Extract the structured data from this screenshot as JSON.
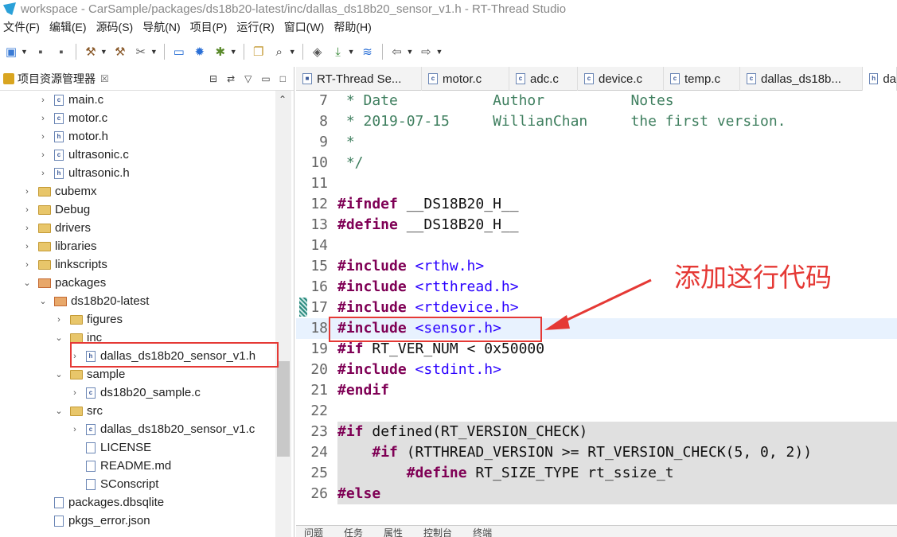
{
  "window": {
    "title": "workspace - CarSample/packages/ds18b20-latest/inc/dallas_ds18b20_sensor_v1.h - RT-Thread Studio"
  },
  "menu": [
    "文件(F)",
    "编辑(E)",
    "源码(S)",
    "导航(N)",
    "项目(P)",
    "运行(R)",
    "窗口(W)",
    "帮助(H)"
  ],
  "explorer": {
    "title": "项目资源管理器",
    "close": "☒",
    "items": [
      {
        "label": "main.c",
        "type": "c"
      },
      {
        "label": "motor.c",
        "type": "c"
      },
      {
        "label": "motor.h",
        "type": "h"
      },
      {
        "label": "ultrasonic.c",
        "type": "c"
      },
      {
        "label": "ultrasonic.h",
        "type": "h"
      },
      {
        "label": "cubemx",
        "type": "dir"
      },
      {
        "label": "Debug",
        "type": "dir"
      },
      {
        "label": "drivers",
        "type": "dir"
      },
      {
        "label": "libraries",
        "type": "dir"
      },
      {
        "label": "linkscripts",
        "type": "dir"
      },
      {
        "label": "packages",
        "type": "pkg"
      },
      {
        "label": "ds18b20-latest",
        "type": "pkg"
      },
      {
        "label": "figures",
        "type": "dir"
      },
      {
        "label": "inc",
        "type": "dir"
      },
      {
        "label": "dallas_ds18b20_sensor_v1.h",
        "type": "h"
      },
      {
        "label": "sample",
        "type": "dir"
      },
      {
        "label": "ds18b20_sample.c",
        "type": "c"
      },
      {
        "label": "src",
        "type": "dir"
      },
      {
        "label": "dallas_ds18b20_sensor_v1.c",
        "type": "c"
      },
      {
        "label": "LICENSE",
        "type": "file"
      },
      {
        "label": "README.md",
        "type": "file"
      },
      {
        "label": "SConscript",
        "type": "file"
      },
      {
        "label": "packages.dbsqlite",
        "type": "file"
      },
      {
        "label": "pkgs_error.json",
        "type": "file"
      }
    ]
  },
  "tabs": [
    "RT-Thread Se...",
    "motor.c",
    "adc.c",
    "device.c",
    "temp.c",
    "dallas_ds18b...",
    "da"
  ],
  "code": [
    {
      "n": "7",
      "segments": [
        {
          "c": "cm",
          "t": " * Date           Author          Notes"
        }
      ]
    },
    {
      "n": "8",
      "segments": [
        {
          "c": "cm",
          "t": " * 2019-07-15     WillianChan     the first version."
        }
      ]
    },
    {
      "n": "9",
      "segments": [
        {
          "c": "cm",
          "t": " *"
        }
      ]
    },
    {
      "n": "10",
      "segments": [
        {
          "c": "cm",
          "t": " */"
        }
      ]
    },
    {
      "n": "11",
      "segments": []
    },
    {
      "n": "12",
      "segments": [
        {
          "c": "kw",
          "t": "#ifndef"
        },
        {
          "c": "nm",
          "t": " __DS18B20_H__"
        }
      ]
    },
    {
      "n": "13",
      "segments": [
        {
          "c": "kw",
          "t": "#define"
        },
        {
          "c": "nm",
          "t": " __DS18B20_H__"
        }
      ]
    },
    {
      "n": "14",
      "segments": []
    },
    {
      "n": "15",
      "segments": [
        {
          "c": "kw",
          "t": "#include"
        },
        {
          "c": "str",
          "t": " <rthw.h>"
        }
      ]
    },
    {
      "n": "16",
      "segments": [
        {
          "c": "kw",
          "t": "#include"
        },
        {
          "c": "str",
          "t": " <rtthread.h>"
        }
      ]
    },
    {
      "n": "17",
      "segments": [
        {
          "c": "kw",
          "t": "#include"
        },
        {
          "c": "str",
          "t": " <rtdevice.h>"
        }
      ]
    },
    {
      "n": "18",
      "segments": [
        {
          "c": "kw",
          "t": "#include"
        },
        {
          "c": "str",
          "t": " <sensor.h>"
        }
      ]
    },
    {
      "n": "19",
      "segments": [
        {
          "c": "kw",
          "t": "#if"
        },
        {
          "c": "nm",
          "t": " RT_VER_NUM < 0x50000"
        }
      ]
    },
    {
      "n": "20",
      "segments": [
        {
          "c": "kw",
          "t": "#include"
        },
        {
          "c": "str",
          "t": " <stdint.h>"
        }
      ]
    },
    {
      "n": "21",
      "segments": [
        {
          "c": "kw",
          "t": "#endif"
        }
      ]
    },
    {
      "n": "22",
      "segments": []
    },
    {
      "n": "23",
      "segments": [
        {
          "c": "kw",
          "t": "#if"
        },
        {
          "c": "nm",
          "t": " defined(RT_VERSION_CHECK)"
        }
      ]
    },
    {
      "n": "24",
      "segments": [
        {
          "c": "nm",
          "t": "    "
        },
        {
          "c": "kw",
          "t": "#if"
        },
        {
          "c": "nm",
          "t": " (RTTHREAD_VERSION >= RT_VERSION_CHECK(5, 0, 2))"
        }
      ]
    },
    {
      "n": "25",
      "segments": [
        {
          "c": "nm",
          "t": "        "
        },
        {
          "c": "kw",
          "t": "#define"
        },
        {
          "c": "nm",
          "t": " RT_SIZE_TYPE rt_ssize_t"
        }
      ]
    },
    {
      "n": "26",
      "segments": [
        {
          "c": "kw",
          "t": "#else"
        }
      ]
    }
  ],
  "annotation": "添加这行代码",
  "bottom_tabs": [
    "问题",
    "任务",
    "属性",
    "控制台",
    "终端"
  ]
}
